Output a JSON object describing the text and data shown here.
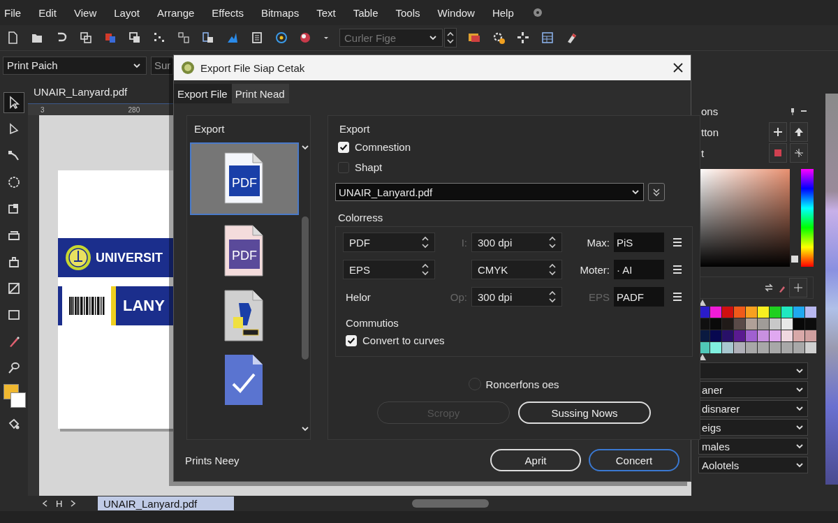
{
  "menu_bar": {
    "items": [
      "File",
      "Edit",
      "View",
      "Layot",
      "Arrange",
      "Effects",
      "Bitmaps",
      "Text",
      "Table",
      "Tools",
      "Window",
      "Help"
    ]
  },
  "toolbar": {
    "font_box": {
      "value": "Curler Fige",
      "disabled": true
    }
  },
  "property_bar": {
    "preset": "Print Paich",
    "field_2": "Sur"
  },
  "toolbox": [
    {
      "selected": true
    },
    {
      "selected": false
    },
    {
      "selected": false
    },
    {
      "selected": false
    },
    {
      "selected": false
    },
    {
      "selected": false
    },
    {
      "selected": false
    },
    {
      "selected": false
    },
    {
      "selected": false
    },
    {
      "selected": false
    },
    {
      "selected": false
    },
    {
      "selected": false
    }
  ],
  "document": {
    "tab": "UNAIR_Lanyard.pdf",
    "ruler": [
      "3",
      "280"
    ],
    "page": {
      "banner_title": "UNIVERSIT",
      "banner_subtitle": "LANY"
    }
  },
  "dialog": {
    "title": "Export File Siap Cetak",
    "tabs": [
      {
        "label": "Export File",
        "selected": true
      },
      {
        "label": "Print Nead",
        "selected": false
      }
    ],
    "format_list": {
      "title": "Export",
      "items": [
        {
          "kind": "pdf",
          "label": "PDF",
          "selected": true
        },
        {
          "kind": "pdfx",
          "label": "PDF",
          "selected": false
        },
        {
          "kind": "print",
          "selected": false
        },
        {
          "kind": "check",
          "selected": false
        }
      ]
    },
    "export": {
      "title": "Export",
      "checkboxes": [
        {
          "label": "Comnestion",
          "checked": true
        },
        {
          "label": "Shapt",
          "checked": false
        }
      ],
      "file": "UNAIR_Lanyard.pdf",
      "colorress": {
        "title": "Colorress",
        "rows": [
          {
            "first": {
              "kind": "spinner",
              "value": "PDF"
            },
            "label_2": {
              "text": "I:",
              "dim": true
            },
            "spinner_2": "300 dpi",
            "label_3": {
              "text": "Max:",
              "dim": false
            },
            "field": "PiS"
          },
          {
            "first": {
              "kind": "spinner",
              "value": "EPS"
            },
            "spinner_2": "CMYK",
            "label_3": {
              "text": "Moter:",
              "dim": false
            },
            "field": "· AI"
          },
          {
            "first": {
              "kind": "label",
              "value": "Helor"
            },
            "label_2": {
              "text": "Op:",
              "dim": true
            },
            "spinner_2": "300 dpi",
            "label_3": {
              "text": "EPS",
              "dim": true
            },
            "field": "PADF"
          }
        ]
      },
      "commutios": {
        "title": "Commutios",
        "checkboxes": [
          {
            "label": "Convert to curves",
            "checked": true
          }
        ]
      },
      "radio": {
        "label": "Roncerfons oes",
        "selected": false
      },
      "actions": [
        {
          "label": "Scropy",
          "disabled": true
        },
        {
          "label": "Sussing Nows",
          "disabled": false
        }
      ]
    },
    "footer": {
      "note": "Prints Neey",
      "buttons": [
        {
          "label": "Aprit",
          "default": false
        },
        {
          "label": "Concert",
          "default": true
        }
      ]
    }
  },
  "right_panel": {
    "header": "ons",
    "hue": {
      "level": 0.08
    },
    "rows": [
      "tton",
      "t"
    ],
    "dropdowns": [
      {
        "kind": "blank"
      },
      {
        "kind": "text",
        "label": "aner"
      },
      {
        "kind": "text",
        "label": "disnarer"
      },
      {
        "kind": "text",
        "label": "eigs"
      },
      {
        "kind": "text",
        "label": "males"
      },
      {
        "kind": "text",
        "label": "Aolotels"
      }
    ]
  },
  "bottom_bar": {
    "nav_label": "H",
    "page_tab": "UNAIR_Lanyard.pdf"
  }
}
